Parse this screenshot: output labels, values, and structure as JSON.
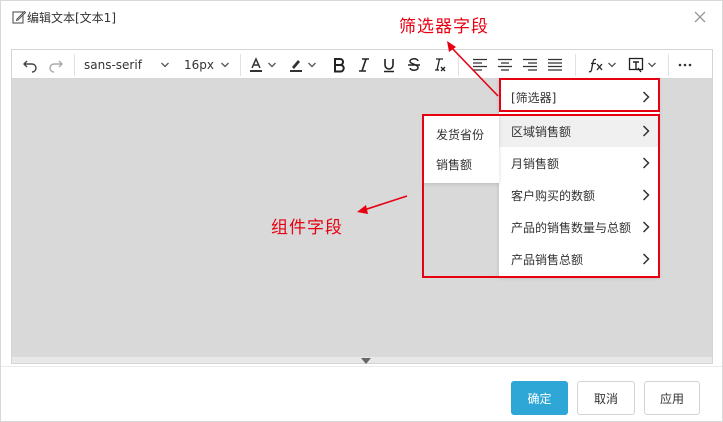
{
  "dialog": {
    "title": "编辑文本[文本1]"
  },
  "toolbar": {
    "font_family": "sans-serif",
    "font_size": "16px",
    "icons": [
      "undo-icon",
      "redo-icon",
      "font-color-icon",
      "highlight-icon",
      "bold-icon",
      "italic-icon",
      "underline-icon",
      "strikethrough-icon",
      "clear-format-icon",
      "align-left-icon",
      "align-center-icon",
      "align-right-icon",
      "align-justify-icon",
      "formula-icon",
      "insert-field-icon",
      "more-icon"
    ]
  },
  "menu_main": {
    "items": [
      {
        "label": "[筛选器]"
      },
      {
        "label": "区域销售额"
      },
      {
        "label": "月销售额"
      },
      {
        "label": "客户购买的数额"
      },
      {
        "label": "产品的销售数量与总额"
      },
      {
        "label": "产品销售总额"
      }
    ]
  },
  "menu_sub": {
    "items": [
      {
        "label": "发货省份"
      },
      {
        "label": "销售额"
      }
    ]
  },
  "annotations": {
    "filter_field": "筛选器字段",
    "component_field": "组件字段"
  },
  "buttons": {
    "confirm": "确定",
    "cancel": "取消",
    "apply": "应用"
  },
  "colors": {
    "primary": "#2ea6d6",
    "annotation": "#e60012",
    "editor_bg": "#d9d9d9"
  }
}
